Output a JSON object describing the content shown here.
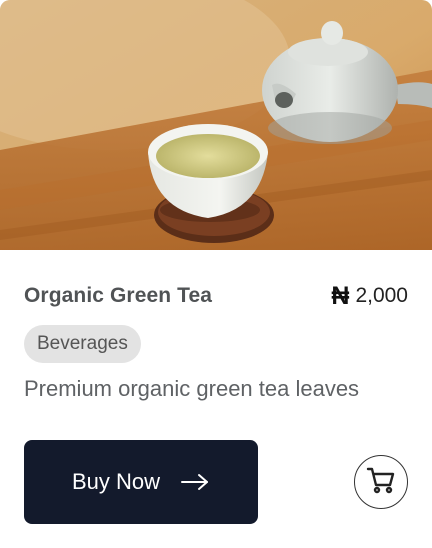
{
  "product": {
    "name": "Organic Green Tea",
    "currency_symbol": "₦",
    "price": "2,000",
    "category": "Beverages",
    "description": "Premium organic green tea leaves",
    "image_subject": "green tea cup and white teapot on wooden table"
  },
  "actions": {
    "buy_label": "Buy Now",
    "buy_icon": "arrow-right-icon",
    "cart_icon": "shopping-cart-icon"
  },
  "colors": {
    "button_bg": "#131a2c",
    "pill_bg": "#e3e3e3",
    "title_text": "#505355"
  }
}
